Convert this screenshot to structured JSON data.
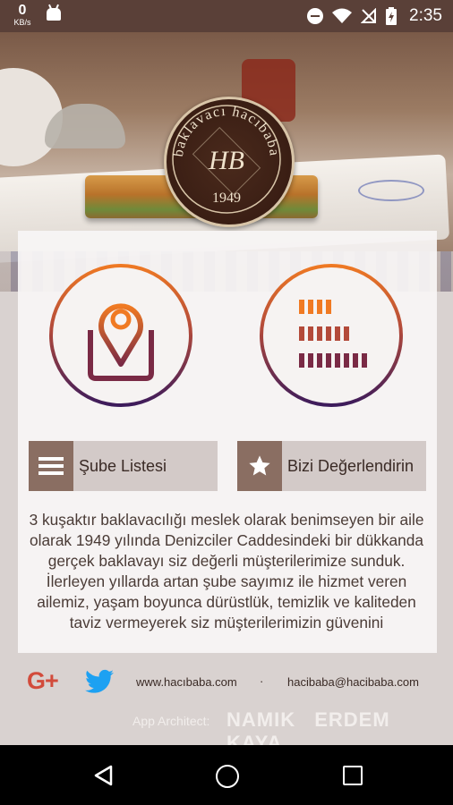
{
  "status_bar": {
    "net_speed": "0",
    "net_unit": "KB/s",
    "time": "2:35"
  },
  "logo": {
    "brand_text": "baklavacı hacıbaba",
    "monogram": "HB",
    "year": "1949"
  },
  "menu": {
    "branches_label": "Şube Listesi",
    "rate_label": "Bizi Değerlendirin"
  },
  "description": "3 kuşaktır baklavacılığı meslek olarak benimseyen bir aile olarak 1949 yılında Denizciler Caddesindeki bir dükkanda gerçek baklavayı siz değerli müşterilerimize sunduk. İlerleyen yıllarda artan şube sayımız ile hizmet veren ailemiz, yaşam boyunca dürüstlük, temizlik ve kaliteden taviz vermeyerek siz müşterilerimizin güvenini",
  "footer": {
    "gplus": "G+",
    "website": "www.hacıbaba.com",
    "separator": "·",
    "email": "hacibaba@hacibaba.com",
    "architect_label": "App Architect:",
    "architect_names": "NAMIK ERDEM KAYA"
  },
  "colors": {
    "accent_orange": "#f07a23",
    "accent_purple": "#3a1a5c",
    "brown": "#8a6e62"
  }
}
